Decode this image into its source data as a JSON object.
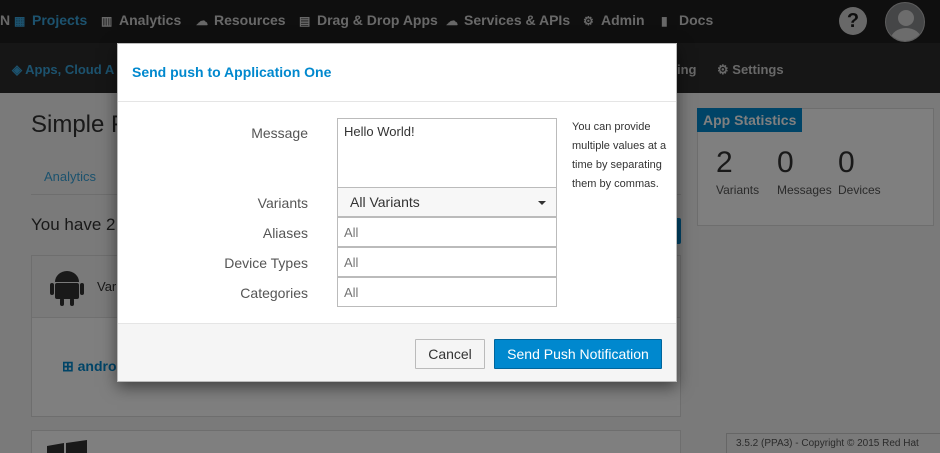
{
  "topnav": {
    "brand_letter": "N",
    "items": [
      {
        "label": "Projects",
        "icon": "grid-icon"
      },
      {
        "label": "Analytics",
        "icon": "bar-chart-icon"
      },
      {
        "label": "Resources",
        "icon": "cloud-icon"
      },
      {
        "label": "Drag & Drop Apps",
        "icon": "table-icon"
      },
      {
        "label": "Services & APIs",
        "icon": "cloud-upload-icon"
      },
      {
        "label": "Admin",
        "icon": "cogs-icon"
      },
      {
        "label": "Docs",
        "icon": "book-icon"
      }
    ],
    "help_label": "?"
  },
  "subnav": {
    "breadcrumb": "Apps, Cloud A",
    "items": [
      {
        "label": "ing",
        "icon": ""
      },
      {
        "label": "Settings",
        "icon": "gear-icon"
      }
    ]
  },
  "page": {
    "title": "Simple F",
    "tab_analytics": "Analytics",
    "you_have": "You have 2",
    "variant_label": "Vari",
    "variant_link": "andro"
  },
  "stats": {
    "label": "App Statistics",
    "items": [
      {
        "num": "2",
        "caption": "Variants"
      },
      {
        "num": "0",
        "caption": "Messages"
      },
      {
        "num": "0",
        "caption": "Devices"
      }
    ]
  },
  "footer": "3.5.2 (PPA3) - Copyright © 2015 Red Hat",
  "modal": {
    "title": "Send push to Application One",
    "message_label": "Message",
    "message_value": "Hello World!",
    "variants_label": "Variants",
    "variants_value": "All Variants",
    "aliases_label": "Aliases",
    "aliases_placeholder": "All",
    "device_types_label": "Device Types",
    "device_types_placeholder": "All",
    "categories_label": "Categories",
    "categories_placeholder": "All",
    "help_text": "You can provide multiple values at a time by separating them by commas.",
    "cancel_label": "Cancel",
    "send_label": "Send Push Notification"
  },
  "colors": {
    "accent": "#0088ce",
    "nav_bg": "#1f1f1f",
    "link": "#39a5dc"
  }
}
